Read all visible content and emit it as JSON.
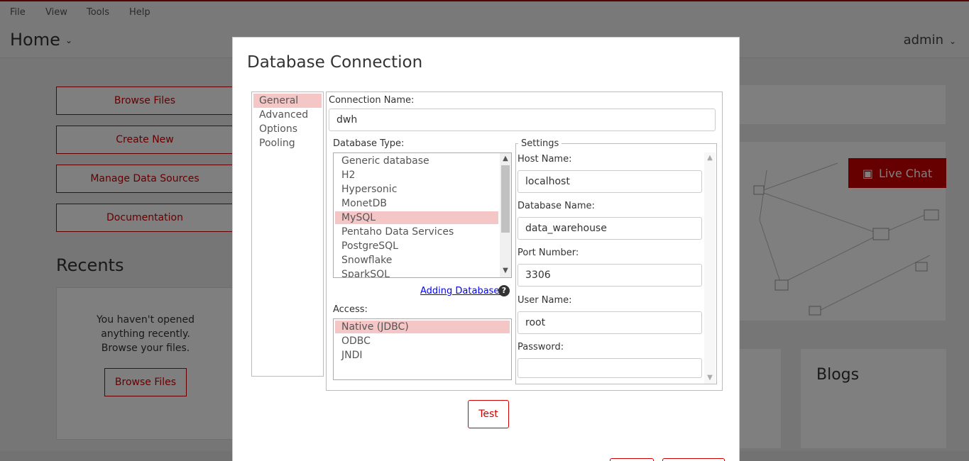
{
  "menubar": {
    "items": [
      "File",
      "View",
      "Tools",
      "Help"
    ]
  },
  "header": {
    "title": "Home",
    "user": "admin"
  },
  "sidebar": {
    "buttons": [
      "Browse Files",
      "Create New",
      "Manage Data Sources",
      "Documentation"
    ]
  },
  "recents": {
    "title": "Recents",
    "empty_line1": "You haven't opened",
    "empty_line2": "anything recently.",
    "empty_line3": "Browse your files.",
    "browse_label": "Browse Files"
  },
  "right": {
    "live_chat": "Live Chat",
    "blogs": "Blogs"
  },
  "dialog": {
    "title": "Database Connection",
    "nav": [
      "General",
      "Advanced",
      "Options",
      "Pooling"
    ],
    "nav_active": "General",
    "connection_name_label": "Connection Name:",
    "connection_name": "dwh",
    "database_type_label": "Database Type:",
    "database_types": [
      "Generic database",
      "H2",
      "Hypersonic",
      "MonetDB",
      "MySQL",
      "Pentaho Data Services",
      "PostgreSQL",
      "Snowflake",
      "SparkSQL"
    ],
    "database_type_selected": "MySQL",
    "adding_databases_link": "Adding Databases",
    "help_icon": "?",
    "access_label": "Access:",
    "access_options": [
      "Native (JDBC)",
      "ODBC",
      "JNDI"
    ],
    "access_selected": "Native (JDBC)",
    "settings_legend": "Settings",
    "host_name_label": "Host Name:",
    "host_name": "localhost",
    "database_name_label": "Database Name:",
    "database_name": "data_warehouse",
    "port_label": "Port Number:",
    "port": "3306",
    "user_name_label": "User Name:",
    "user_name": "root",
    "password_label": "Password:",
    "password": "",
    "test_label": "Test"
  },
  "colors": {
    "accent": "#cc0000",
    "selection": "#f5c6c6",
    "link": "#0000ff"
  }
}
